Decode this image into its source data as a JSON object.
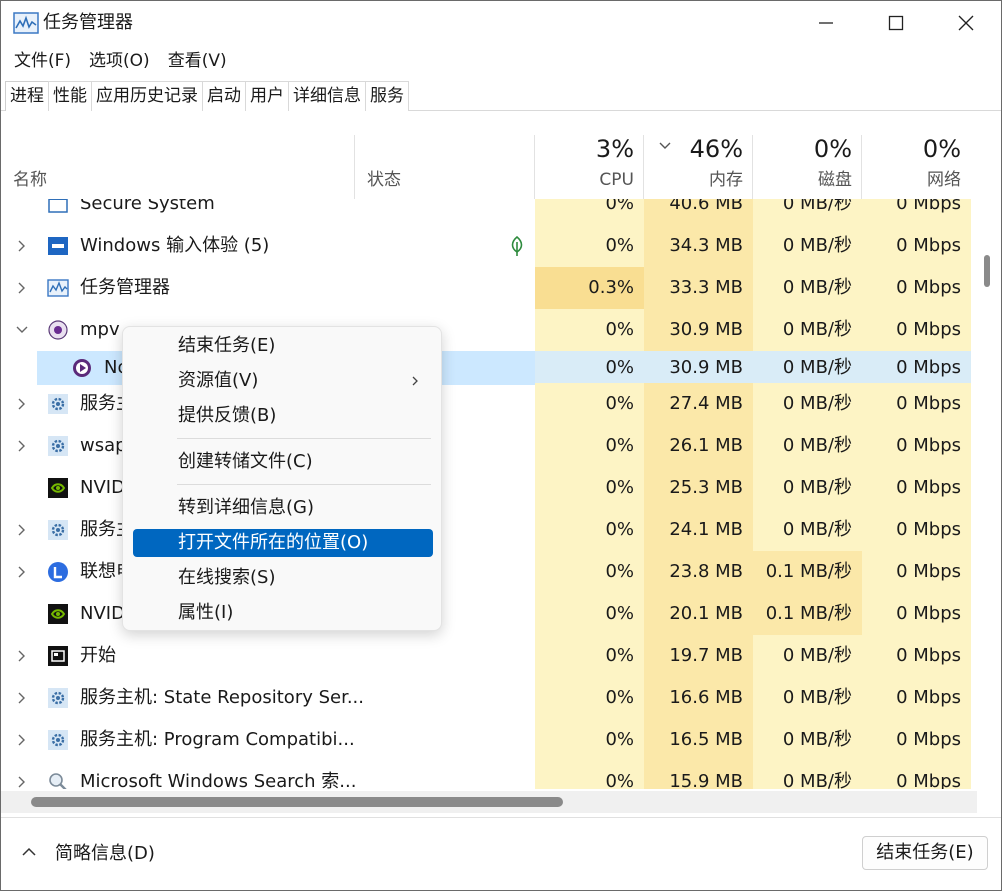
{
  "window": {
    "title": "任务管理器"
  },
  "menu": [
    "文件(F)",
    "选项(O)",
    "查看(V)"
  ],
  "tabs": [
    "进程",
    "性能",
    "应用历史记录",
    "启动",
    "用户",
    "详细信息",
    "服务"
  ],
  "columns": {
    "name": "名称",
    "status": "状态",
    "cpu": {
      "pct": "3%",
      "label": "CPU"
    },
    "mem": {
      "pct": "46%",
      "label": "内存"
    },
    "disk": {
      "pct": "0%",
      "label": "磁盘"
    },
    "net": {
      "pct": "0%",
      "label": "网络"
    }
  },
  "rows": [
    {
      "name": "Secure System",
      "cpu": "0%",
      "mem": "40.6 MB",
      "disk": "0 MB/秒",
      "net": "0 Mbps"
    },
    {
      "name": "Windows 输入体验 (5)",
      "cpu": "0%",
      "mem": "34.3 MB",
      "disk": "0 MB/秒",
      "net": "0 Mbps"
    },
    {
      "name": "任务管理器",
      "cpu": "0.3%",
      "mem": "33.3 MB",
      "disk": "0 MB/秒",
      "net": "0 Mbps"
    },
    {
      "name": "mpv",
      "cpu": "0%",
      "mem": "30.9 MB",
      "disk": "0 MB/秒",
      "net": "0 Mbps"
    },
    {
      "name": "No",
      "cpu": "0%",
      "mem": "30.9 MB",
      "disk": "0 MB/秒",
      "net": "0 Mbps"
    },
    {
      "name": "服务主",
      "cpu": "0%",
      "mem": "27.4 MB",
      "disk": "0 MB/秒",
      "net": "0 Mbps"
    },
    {
      "name": "wsap",
      "cpu": "0%",
      "mem": "26.1 MB",
      "disk": "0 MB/秒",
      "net": "0 Mbps"
    },
    {
      "name": "NVID",
      "cpu": "0%",
      "mem": "25.3 MB",
      "disk": "0 MB/秒",
      "net": "0 Mbps"
    },
    {
      "name": "服务主",
      "cpu": "0%",
      "mem": "24.1 MB",
      "disk": "0 MB/秒",
      "net": "0 Mbps"
    },
    {
      "name": "联想电",
      "cpu": "0%",
      "mem": "23.8 MB",
      "disk": "0.1 MB/秒",
      "net": "0 Mbps"
    },
    {
      "name": "NVID",
      "cpu": "0%",
      "mem": "20.1 MB",
      "disk": "0.1 MB/秒",
      "net": "0 Mbps"
    },
    {
      "name": "开始",
      "cpu": "0%",
      "mem": "19.7 MB",
      "disk": "0 MB/秒",
      "net": "0 Mbps"
    },
    {
      "name": "服务主机: State Repository Ser...",
      "cpu": "0%",
      "mem": "16.6 MB",
      "disk": "0 MB/秒",
      "net": "0 Mbps"
    },
    {
      "name": "服务主机: Program Compatibi...",
      "cpu": "0%",
      "mem": "16.5 MB",
      "disk": "0 MB/秒",
      "net": "0 Mbps"
    },
    {
      "name": "Microsoft Windows Search 索...",
      "cpu": "0%",
      "mem": "15.9 MB",
      "disk": "0 MB/秒",
      "net": "0 Mbps"
    }
  ],
  "context_menu": {
    "end_task": "结束任务(E)",
    "resource_values": "资源值(V)",
    "feedback": "提供反馈(B)",
    "create_dump": "创建转储文件(C)",
    "go_details": "转到详细信息(G)",
    "open_location": "打开文件所在的位置(O)",
    "search_online": "在线搜索(S)",
    "properties": "属性(I)"
  },
  "footer": {
    "brief": "简略信息(D)",
    "end_task": "结束任务(E)"
  },
  "colors": {
    "accent": "#0067c0",
    "selection": "#cce8ff",
    "heat_low": "#fdf4c5",
    "heat_mid": "#fbe8a9",
    "heat_high": "#f9de92"
  }
}
